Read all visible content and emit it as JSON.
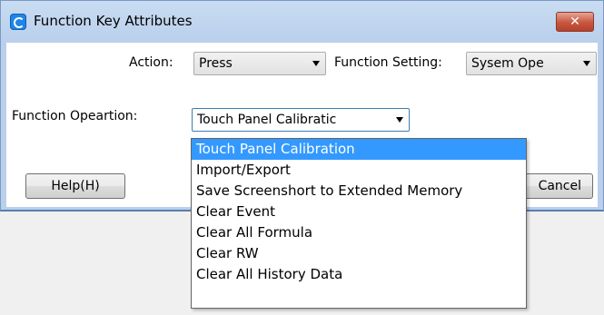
{
  "window": {
    "title": "Function Key Attributes",
    "close_label": "✕",
    "app_icon": "app-logo-icon"
  },
  "form": {
    "action_label": "Action:",
    "action_value": "Press",
    "function_setting_label": "Function Setting:",
    "function_setting_value": "Sysem Ope",
    "function_operation_label": "Function Opeartion:",
    "function_operation_value": "Touch Panel Calibratic"
  },
  "buttons": {
    "help_label": "Help(H)",
    "cancel_label": "Cancel"
  },
  "dropdown": {
    "items": [
      "Touch Panel Calibration",
      "Import/Export",
      "Save Screenshort to Extended Memory",
      "Clear Event",
      "Clear All Formula",
      "Clear RW",
      "Clear All History Data"
    ],
    "selected_index": 0
  },
  "colors": {
    "selection": "#3399ff",
    "titlebar": "#b9cfeb",
    "close_button": "#c7563f"
  }
}
